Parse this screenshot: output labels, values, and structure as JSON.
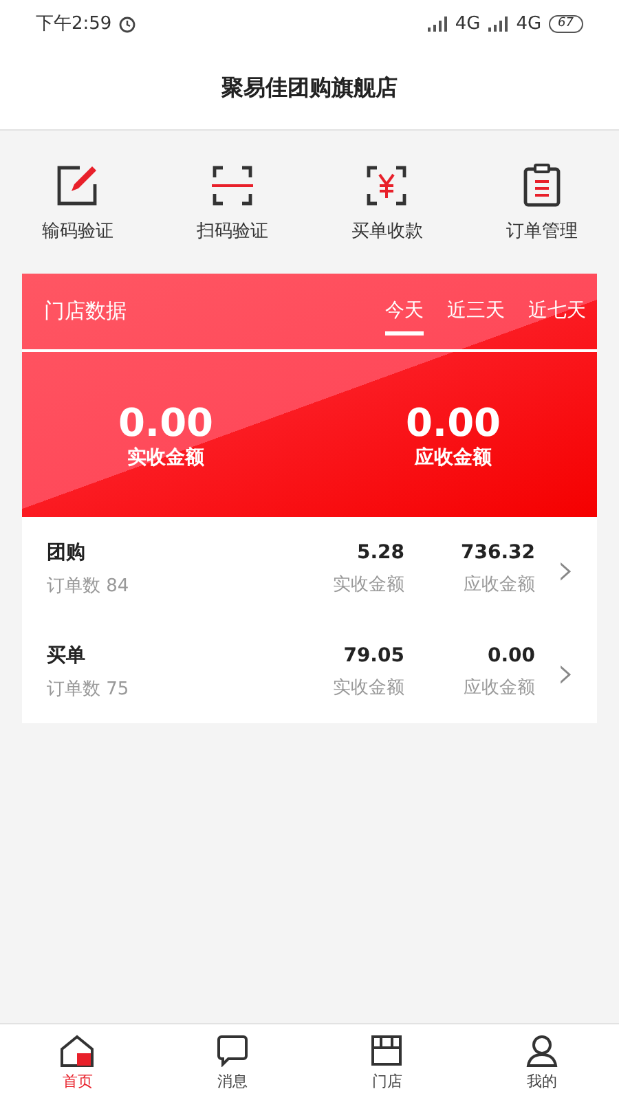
{
  "status_bar": {
    "time": "下午2:59",
    "network_1": "4G",
    "network_2": "4G",
    "battery": "67"
  },
  "header": {
    "title": "聚易佳团购旗舰店"
  },
  "actions": [
    {
      "kind": "edit",
      "label": "输码验证"
    },
    {
      "kind": "scan",
      "label": "扫码验证"
    },
    {
      "kind": "yuan",
      "label": "买单收款"
    },
    {
      "kind": "clipboard",
      "label": "订单管理"
    }
  ],
  "store_data": {
    "title": "门店数据",
    "tabs": [
      {
        "label": "今天",
        "selected": true
      },
      {
        "label": "近三天",
        "selected": false
      },
      {
        "label": "近七天",
        "selected": false
      }
    ],
    "totals": [
      {
        "value": "0.00",
        "label": "实收金额"
      },
      {
        "value": "0.00",
        "label": "应收金额"
      }
    ]
  },
  "orders": [
    {
      "name": "团购",
      "count": "订单数 84",
      "received": "5.28",
      "received_label": "实收金额",
      "receivable": "736.32",
      "receivable_label": "应收金额",
      "chevron": "›"
    },
    {
      "name": "买单",
      "count": "订单数 75",
      "received": "79.05",
      "received_label": "实收金额",
      "receivable": "0.00",
      "receivable_label": "应收金额",
      "chevron": "›"
    }
  ],
  "tab_bar": [
    {
      "kind": "home",
      "label": "首页",
      "selected": true
    },
    {
      "kind": "message",
      "label": "消息",
      "selected": false
    },
    {
      "kind": "store",
      "label": "门店",
      "selected": false
    },
    {
      "kind": "user",
      "label": "我的",
      "selected": false
    }
  ]
}
